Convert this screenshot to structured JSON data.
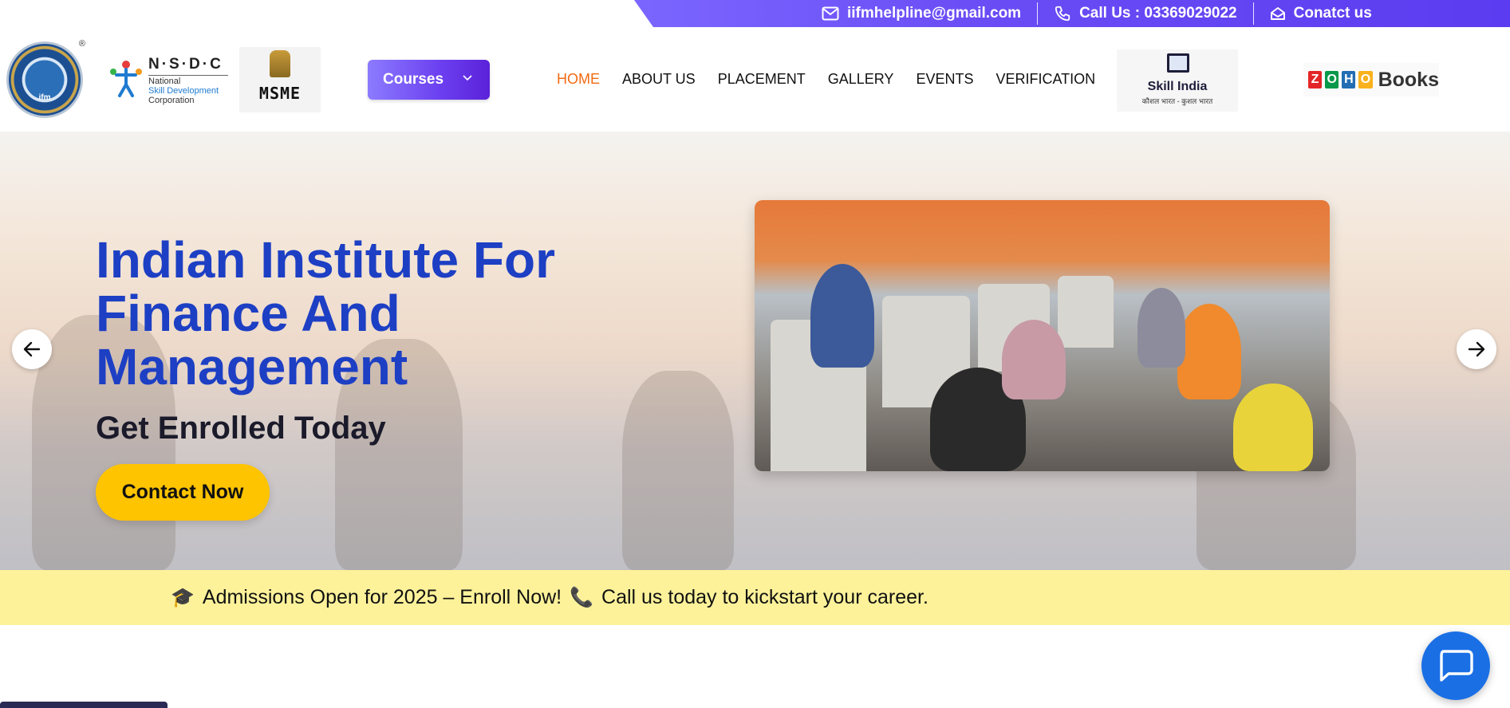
{
  "topbar": {
    "email": "iifmhelpline@gmail.com",
    "call": "Call Us : 03369029022",
    "contact": "Conatct us",
    "icons": [
      "mail-icon",
      "phone-icon",
      "open-envelope-icon"
    ]
  },
  "header": {
    "logos": {
      "iifm": "ifm",
      "nsdc_title": "N·S·D·C",
      "nsdc_line1": "National",
      "nsdc_line2": "Skill Development",
      "nsdc_line3": "Corporation",
      "msme": "MSME",
      "skill_india": "Skill India",
      "skill_india_tagline": "कौशल भारत - कुशल भारत",
      "zoho_letters": [
        "Z",
        "O",
        "H",
        "O"
      ],
      "zoho_books": "Books"
    },
    "courses_label": "Courses",
    "nav": [
      {
        "label": "HOME",
        "active": true
      },
      {
        "label": "ABOUT US",
        "active": false
      },
      {
        "label": "PLACEMENT",
        "active": false
      },
      {
        "label": "GALLERY",
        "active": false
      },
      {
        "label": "EVENTS",
        "active": false
      },
      {
        "label": "VERIFICATION",
        "active": false
      }
    ]
  },
  "hero": {
    "title_line1": "Indian Institute For",
    "title_line2": "Finance And",
    "title_line3": "Management",
    "subtitle": "Get Enrolled Today",
    "cta": "Contact Now"
  },
  "ticker": {
    "text1": "Admissions Open for 2025 – Enroll Now!",
    "text2": "Call us today to kickstart your career.",
    "icons": [
      "graduation-cap-icon",
      "phone-receiver-icon"
    ]
  },
  "colors": {
    "accent_purple": "#6a4df5",
    "nav_active": "#f26a14",
    "hero_title": "#1d3fc4",
    "cta_yellow": "#ffc400",
    "ticker_bg": "#fdf29a",
    "chat_blue": "#1a6fe5"
  }
}
